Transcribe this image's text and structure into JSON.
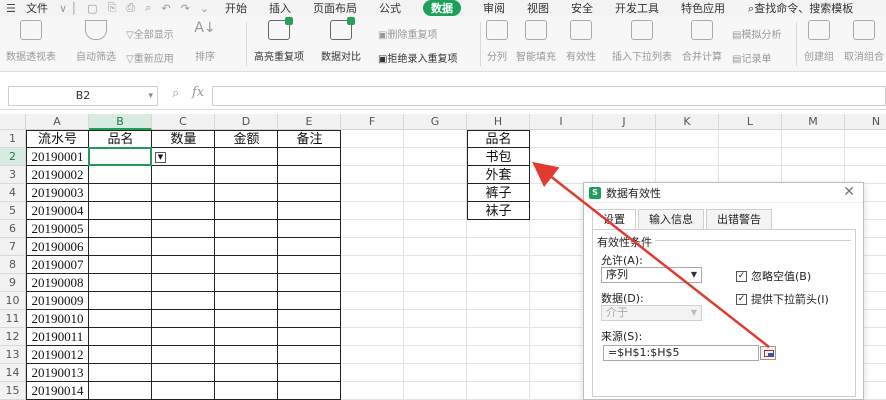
{
  "menubar": {
    "file": "文件",
    "tabs": [
      {
        "label": "开始",
        "active": false
      },
      {
        "label": "插入",
        "active": false
      },
      {
        "label": "页面布局",
        "active": false
      },
      {
        "label": "公式",
        "active": false
      },
      {
        "label": "数据",
        "active": true
      },
      {
        "label": "审阅",
        "active": false
      },
      {
        "label": "视图",
        "active": false
      },
      {
        "label": "安全",
        "active": false
      },
      {
        "label": "开发工具",
        "active": false
      },
      {
        "label": "特色应用",
        "active": false
      }
    ],
    "search": "查找命令、搜索模板"
  },
  "ribbon": {
    "pivot": "数据透视表",
    "autofilter": "自动筛选",
    "show_all": "全部显示",
    "reapply": "重新应用",
    "sort": "排序",
    "highlight_dup": "高亮重复项",
    "compare": "数据对比",
    "remove_dup": "删除重复项",
    "reject_dup": "拒绝录入重复项",
    "split": "分列",
    "smart_fill": "智能填充",
    "validity": "有效性",
    "insert_dropdown": "插入下拉列表",
    "consolidate": "合并计算",
    "simulate": "模拟分析",
    "record": "记录单",
    "group": "创建组",
    "ungroup": "取消组合"
  },
  "formula_bar": {
    "name_box": "B2",
    "fx_label": "fx",
    "formula": ""
  },
  "sheet": {
    "columns": [
      "A",
      "B",
      "C",
      "D",
      "E",
      "F",
      "G",
      "H",
      "I",
      "J",
      "K",
      "L",
      "M",
      "N"
    ],
    "selected_column": "B",
    "rows": [
      "1",
      "2",
      "3",
      "4",
      "5",
      "6",
      "7",
      "8",
      "9",
      "10",
      "11",
      "12",
      "13",
      "14",
      "15"
    ],
    "selected_row": "2",
    "header": [
      "流水号",
      "品名",
      "数量",
      "金额",
      "备注"
    ],
    "serials": [
      "20190001",
      "20190002",
      "20190003",
      "20190004",
      "20190005",
      "20190006",
      "20190007",
      "20190008",
      "20190009",
      "20190010",
      "20190011",
      "20190012",
      "20190013",
      "20190014"
    ],
    "h_header": "品名",
    "h_items": [
      "书包",
      "外套",
      "裤子",
      "袜子"
    ]
  },
  "dialog": {
    "title": "数据有效性",
    "tabs": [
      "设置",
      "输入信息",
      "出错警告"
    ],
    "group_label": "有效性条件",
    "allow_label": "允许(A):",
    "allow_value": "序列",
    "ignore_blank": "忽略空值(B)",
    "ignore_blank_checked": true,
    "data_label": "数据(D):",
    "data_value": "介于",
    "dropdown_arrow": "提供下拉箭头(I)",
    "dropdown_arrow_checked": true,
    "source_label": "来源(S):",
    "source_value": "=$H$1:$H$5"
  },
  "colors": {
    "accent": "#1fa05a",
    "arrow": "#e23a2e"
  }
}
